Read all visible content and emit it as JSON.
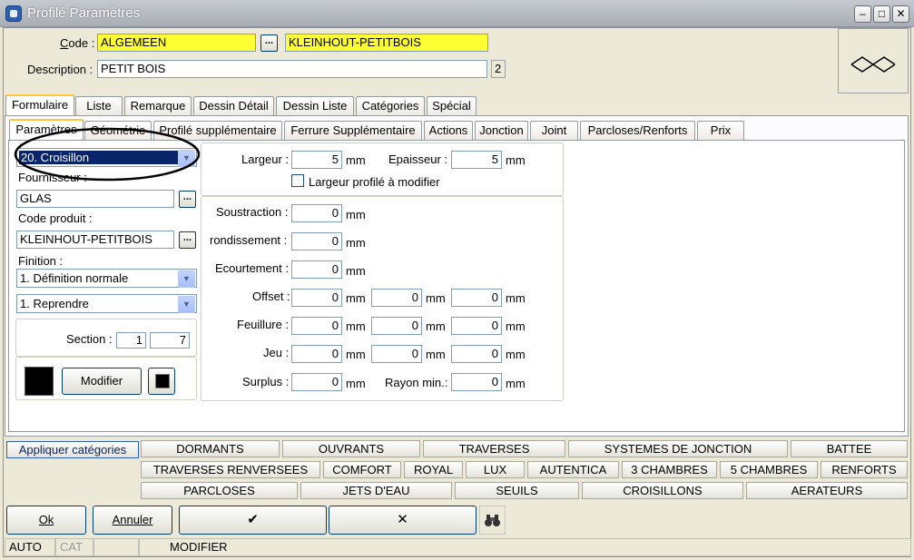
{
  "window": {
    "title": "Profilé Paramètres"
  },
  "header": {
    "code_label": "Code :",
    "code_value": "ALGEMEEN",
    "code_desc": "KLEINHOUT-PETITBOIS",
    "description_label": "Description :",
    "description_value": "PETIT BOIS",
    "description_count": "2",
    "dots_label": "...",
    "preview_symbol": "XX"
  },
  "main_tabs": [
    "Formulaire",
    "Liste",
    "Remarque",
    "Dessin Détail",
    "Dessin Liste",
    "Catégories",
    "Spécial"
  ],
  "sub_tabs": [
    "Paramètres",
    "Géométrie",
    "Profilé supplémentaire",
    "Ferrure Supplémentaire",
    "Actions",
    "Jonction",
    "Joint",
    "Parcloses/Renforts",
    "Prix"
  ],
  "left": {
    "type_select": "20. Croisillon",
    "fournisseur_label": "Fournisseur :",
    "fournisseur_value": "GLAS",
    "code_produit_label": "Code produit :",
    "code_produit_value": "KLEINHOUT-PETITBOIS",
    "finition_label": "Finition :",
    "finition_select": "1.  Définition normale",
    "reprendre_select": "1.  Reprendre",
    "section_label": "Section :",
    "section_a": "1",
    "section_b": "7",
    "modifier_label": "Modifier",
    "color_main": "#000000"
  },
  "top_fields": {
    "largeur_label": "Largeur :",
    "largeur_value": "5",
    "largeur_unit": "mm",
    "epaisseur_label": "Epaisseur :",
    "epaisseur_value": "5",
    "epaisseur_unit": "mm",
    "checkbox_label": "Largeur profilé à modifier"
  },
  "fields": {
    "unit": "mm",
    "soustraction_label": "Soustraction :",
    "soustraction_value": "0",
    "arrondissement_label": "rondissement :",
    "arrondissement_value": "0",
    "ecourtement_label": "Ecourtement :",
    "ecourtement_value": "0",
    "offset_label": "Offset :",
    "offset_values": [
      "0",
      "0",
      "0"
    ],
    "feuillure_label": "Feuillure :",
    "feuillure_values": [
      "0",
      "0",
      "0"
    ],
    "jeu_label": "Jeu :",
    "jeu_values": [
      "0",
      "0",
      "0"
    ],
    "surplus_label": "Surplus :",
    "surplus_value": "0",
    "rayon_label": "Rayon min.:",
    "rayon_value": "0"
  },
  "categories": {
    "apply_label": "Appliquer catégories",
    "row1": [
      "DORMANTS",
      "OUVRANTS",
      "TRAVERSES",
      "SYSTEMES DE JONCTION",
      "BATTEE"
    ],
    "row2": [
      "TRAVERSES RENVERSEES",
      "COMFORT",
      "ROYAL",
      "LUX",
      "AUTENTICA",
      "3 CHAMBRES",
      "5 CHAMBRES",
      "RENFORTS"
    ],
    "row3": [
      "PARCLOSES",
      "JETS D'EAU",
      "SEUILS",
      "CROISILLONS",
      "AERATEURS"
    ]
  },
  "actions": {
    "ok": "Ok",
    "annuler": "Annuler",
    "check": "✔",
    "cross": "✕",
    "binoculars": "‥"
  },
  "status": {
    "auto": "AUTO",
    "cat": "CAT",
    "empty": "",
    "mode": "MODIFIER"
  }
}
